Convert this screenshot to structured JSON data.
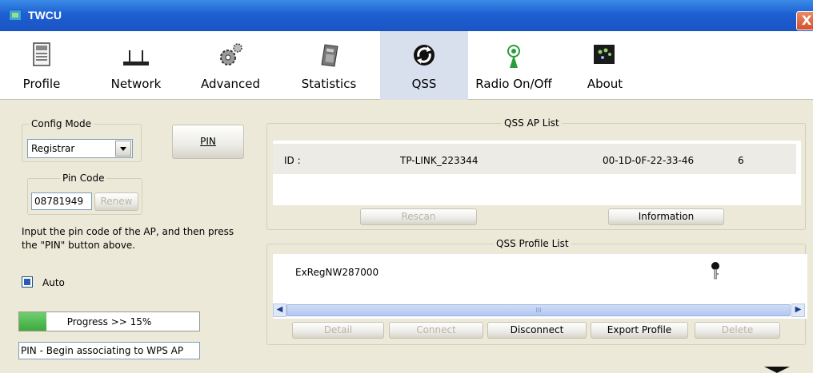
{
  "window": {
    "title": "TWCU",
    "close_glyph": "X"
  },
  "toolbar": {
    "items": [
      {
        "label": "Profile",
        "icon": "profile-icon",
        "active": false
      },
      {
        "label": "Network",
        "icon": "network-icon",
        "active": false
      },
      {
        "label": "Advanced",
        "icon": "advanced-icon",
        "active": false
      },
      {
        "label": "Statistics",
        "icon": "statistics-icon",
        "active": false
      },
      {
        "label": "QSS",
        "icon": "qss-icon",
        "active": true
      },
      {
        "label": "Radio On/Off",
        "icon": "radio-icon",
        "active": false
      },
      {
        "label": "About",
        "icon": "about-icon",
        "active": false
      }
    ]
  },
  "left": {
    "config_mode_label": "Config Mode",
    "config_mode_value": "Registrar",
    "pin_button": "PIN",
    "pin_code_label": "Pin Code",
    "pin_code_value": "08781949",
    "renew_button": "Renew",
    "instruction_line1": "Input the pin code of the AP, and then press",
    "instruction_line2": "the \"PIN\" button above.",
    "auto_label": "Auto",
    "auto_checked": true,
    "progress_text": "Progress >> 15%",
    "progress_value": 0.15,
    "status_text": "PIN - Begin associating to WPS AP"
  },
  "ap_list": {
    "title": "QSS AP List",
    "rows": [
      {
        "id_label": "ID :",
        "ssid": "TP-LINK_223344",
        "bssid": "00-1D-0F-22-33-46",
        "channel": "6"
      }
    ],
    "rescan_button": "Rescan",
    "information_button": "Information"
  },
  "profile_list": {
    "title": "QSS Profile List",
    "rows": [
      {
        "name": "ExRegNW287000",
        "icon": "key-icon"
      }
    ],
    "scroll_thumb_glyph": "III",
    "buttons": {
      "detail": "Detail",
      "connect": "Connect",
      "disconnect": "Disconnect",
      "export": "Export Profile",
      "delete": "Delete"
    }
  },
  "colors": {
    "title_bar": "#1d5fd1",
    "window_bg": "#ece9d8",
    "progress_fill": "#5bbf5b",
    "active_tab": "#d8e0ee"
  }
}
